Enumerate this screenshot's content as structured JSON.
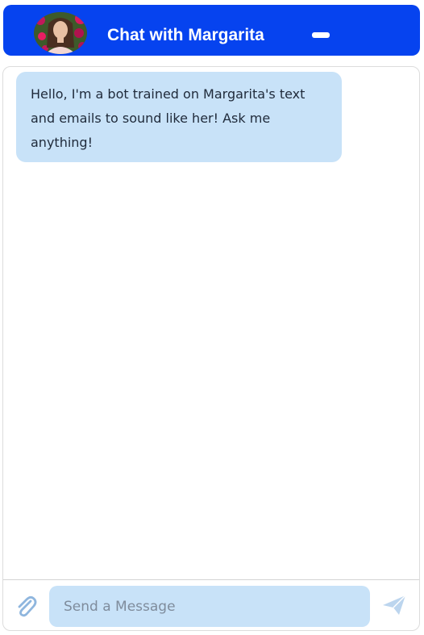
{
  "header": {
    "title": "Chat with Margarita",
    "avatar_icon": "profile-photo",
    "minimize_icon": "minimize-icon"
  },
  "messages": [
    {
      "sender": "bot",
      "text": "Hello, I'm a bot trained on Margarita's text and emails to sound like her! Ask me anything!"
    }
  ],
  "composer": {
    "placeholder": "Send a Message",
    "value": "",
    "attach_icon": "paperclip-icon",
    "send_icon": "paper-plane-icon"
  },
  "colors": {
    "header_bg": "#0643ef",
    "header_text": "#ffffff",
    "bubble_bg": "#c8e2f8",
    "bubble_text": "#1f2a3a",
    "input_bg": "#c8e2f8",
    "icon": "#8fb6de",
    "send_icon": "#bcd5ee"
  }
}
